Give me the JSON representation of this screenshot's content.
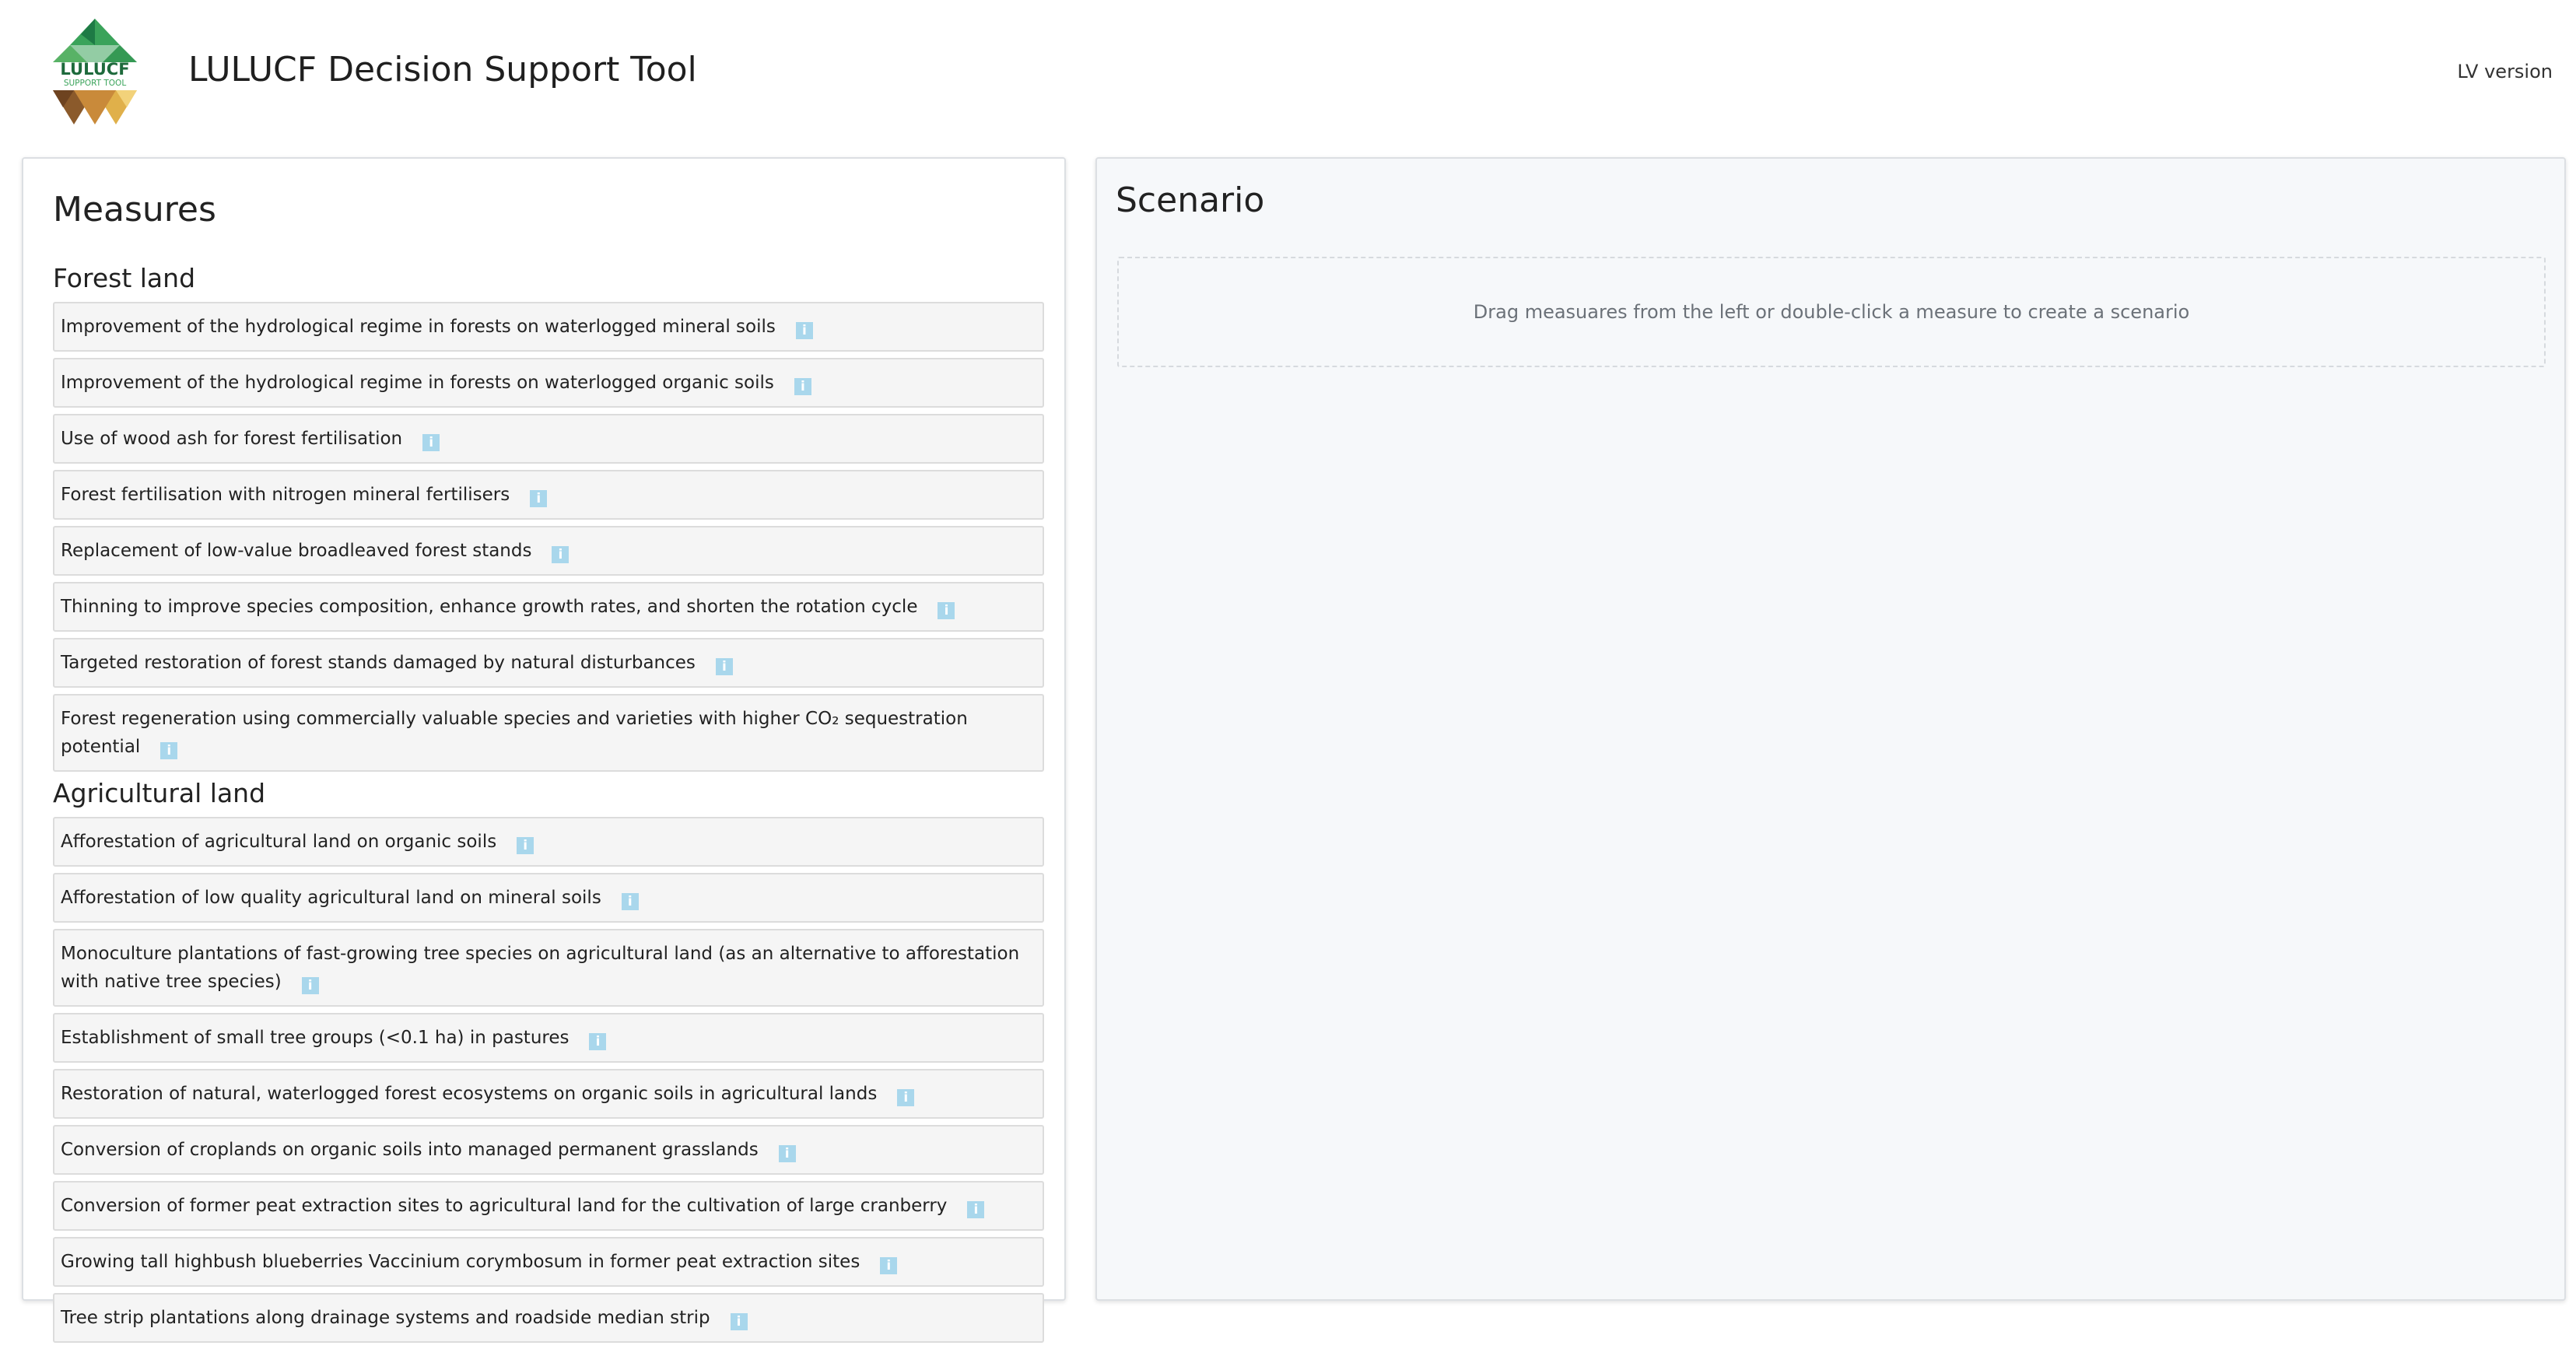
{
  "header": {
    "logo": {
      "brand_text": "LULUCF",
      "sub_text": "SUPPORT TOOL"
    },
    "title": "LULUCF Decision Support Tool",
    "version_label": "LV version"
  },
  "measures": {
    "title": "Measures",
    "info_icon_glyph": "i",
    "sections": [
      {
        "title": "Forest land",
        "items": [
          "Improvement of the hydrological regime in forests on waterlogged mineral soils",
          "Improvement of the hydrological regime in forests on waterlogged organic soils",
          "Use of wood ash for forest fertilisation",
          "Forest fertilisation with nitrogen mineral fertilisers",
          "Replacement of low-value broadleaved forest stands",
          "Thinning to improve species composition, enhance growth rates, and shorten the rotation cycle",
          "Targeted restoration of forest stands damaged by natural disturbances",
          "Forest regeneration using commercially valuable species and varieties with higher CO₂ sequestration potential"
        ]
      },
      {
        "title": "Agricultural land",
        "items": [
          "Afforestation of agricultural land on organic soils",
          "Afforestation of low quality agricultural land on mineral soils",
          "Monoculture plantations of fast-growing tree species on agricultural land (as an alternative to afforestation with native tree species)",
          "Establishment of small tree groups (<0.1 ha) in pastures",
          "Restoration of natural, waterlogged forest ecosystems on organic soils in agricultural lands",
          "Conversion of croplands on organic soils into managed permanent grasslands",
          "Conversion of former peat extraction sites to agricultural land for the cultivation of large cranberry",
          "Growing tall highbush blueberries Vaccinium corymbosum in former peat extraction sites",
          "Tree strip plantations along drainage systems and roadside median strip"
        ]
      }
    ]
  },
  "scenario": {
    "title": "Scenario",
    "dropzone_text": "Drag measuares from the left or double-click a measure to create a scenario"
  },
  "colors": {
    "logo_green_dark": "#1e7a45",
    "logo_green": "#3aa35a",
    "logo_green_light": "#7cc576",
    "logo_brown": "#8b5a2b",
    "logo_gold": "#e0b04a",
    "logo_gold_light": "#f2d27a",
    "info_icon": "#a9d7ec"
  }
}
